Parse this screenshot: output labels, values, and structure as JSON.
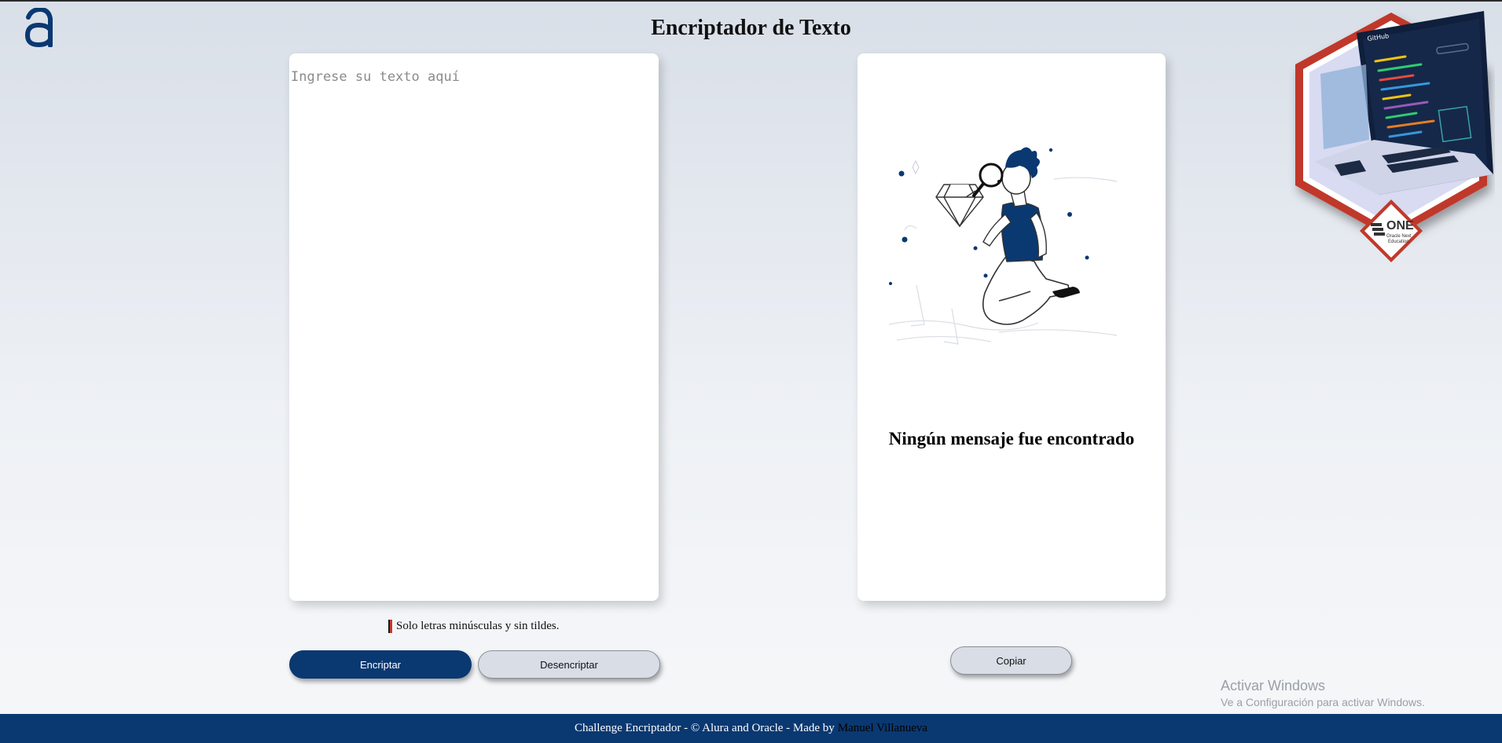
{
  "header": {
    "logo_icon": "alura-logo-icon",
    "title": "Encriptador de Texto"
  },
  "input": {
    "placeholder": "Ingrese su texto aquí",
    "value": ""
  },
  "hint": {
    "icon": "warning-bar-icon",
    "text": "Solo letras minúsculas y sin tildes."
  },
  "buttons": {
    "encrypt_label": "Encriptar",
    "decrypt_label": "Desencriptar",
    "copy_label": "Copiar"
  },
  "output": {
    "illustration": "person-with-magnifier-illustration",
    "message": "Ningún mensaje fue encontrado"
  },
  "badge": {
    "icon": "oracle-one-laptop-badge",
    "brand_text": "ONE",
    "brand_sub_1": "Oracle Next",
    "brand_sub_2": "Education",
    "screen_label": "GitHub"
  },
  "watermark": {
    "title": "Activar Windows",
    "subtitle": "Ve a Configuración para activar Windows."
  },
  "footer": {
    "text": "Challenge Encriptador - © Alura and Oracle - Made by",
    "author": "Manuel Villanueva"
  },
  "colors": {
    "primary": "#0a3871",
    "secondary_button": "#d8dde6",
    "background": "#e4e9f0",
    "card": "#ffffff",
    "footer": "#0a3871"
  }
}
